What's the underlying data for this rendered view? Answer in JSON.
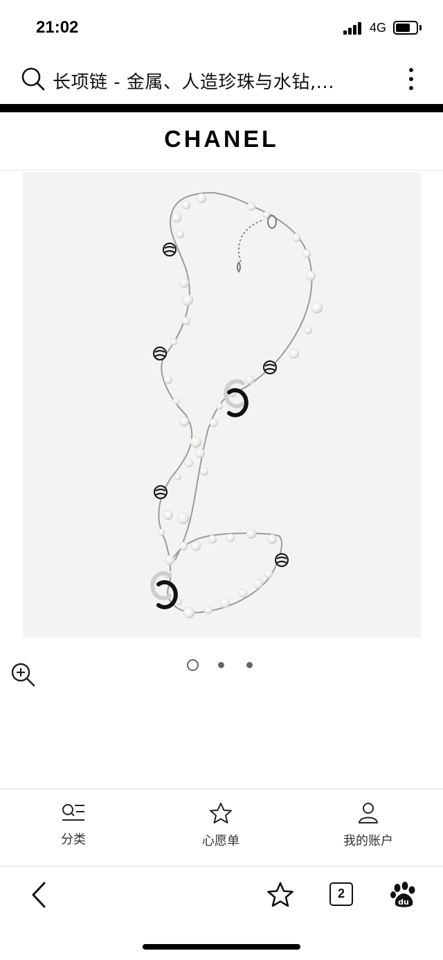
{
  "status_bar": {
    "time": "21:02",
    "network": "4G",
    "battery_level": 0.6
  },
  "address_bar": {
    "title": "长项链 - 金属、人造珍珠与水钻,..."
  },
  "brand": {
    "logo": "CHANEL"
  },
  "product": {
    "image_count": 3,
    "active_image": 1
  },
  "site_nav": {
    "items": [
      {
        "label": "分类",
        "icon": "category-icon"
      },
      {
        "label": "心愿单",
        "icon": "star-icon"
      },
      {
        "label": "我的账户",
        "icon": "user-icon"
      }
    ]
  },
  "browser_toolbar": {
    "tab_count": "2"
  },
  "colors": {
    "accent": "#000000",
    "image_bg": "#f3f3f4",
    "divider": "#dcdcdc"
  }
}
